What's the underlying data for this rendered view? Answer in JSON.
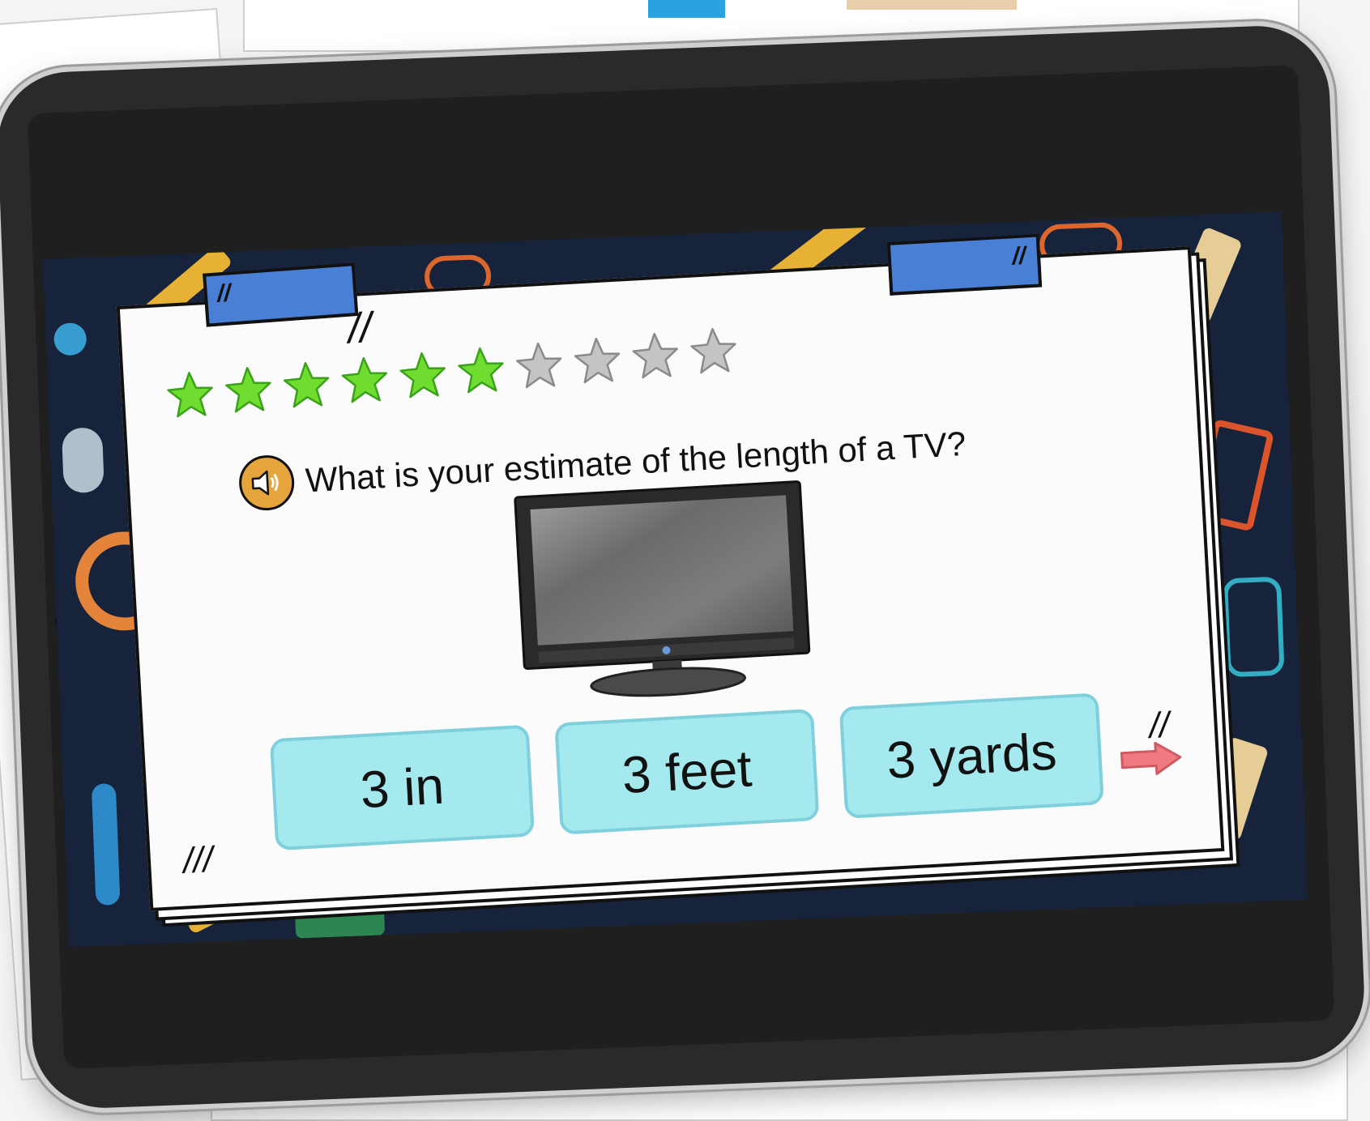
{
  "stars": {
    "total": 10,
    "earned": 6,
    "earned_color": "#6fdc2f",
    "empty_color": "#c4c4c4"
  },
  "question": {
    "text": "What is your estimate of the length of a TV?",
    "speaker_icon": "speaker-icon"
  },
  "answers": [
    {
      "label": "3 in"
    },
    {
      "label": "3 feet"
    },
    {
      "label": "3 yards"
    }
  ],
  "next_icon": "right-arrow-icon",
  "colors": {
    "card_bg": "#fbfbfb",
    "tape": "#4a7fd6",
    "answer_bg": "#a3e9ee",
    "answer_border": "#7fcfdc",
    "speaker_bg": "#e6a43c",
    "arrow": "#ef7a82",
    "game_bg": "#16233a"
  }
}
